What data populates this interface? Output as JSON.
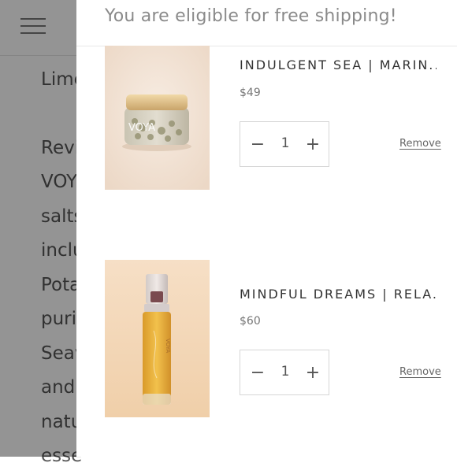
{
  "background_page": {
    "lines": [
      "Lime",
      "Revi",
      "VOY",
      "salts",
      "inclu",
      "Pota",
      "purif",
      "Seav",
      "and",
      "natu",
      "esse"
    ]
  },
  "cart": {
    "shipping_message": "You are eligible for free shipping!",
    "items": [
      {
        "title": "INDULGENT SEA | MARIN...",
        "price": "$49",
        "quantity": "1",
        "remove_label": "Remove",
        "jar_label": "VOYA"
      },
      {
        "title": "MINDFUL DREAMS | RELA...",
        "price": "$60",
        "quantity": "1",
        "remove_label": "Remove",
        "bottle_label": "VOYA"
      }
    ],
    "qty_minus_symbol": "−",
    "qty_plus_symbol": "+"
  },
  "icons": {
    "menu": "hamburger-menu-icon",
    "minus": "minus-icon",
    "plus": "plus-icon"
  },
  "colors": {
    "overlay": "#000000",
    "drawer_bg": "#ffffff",
    "text_muted": "#8a8a8a"
  }
}
